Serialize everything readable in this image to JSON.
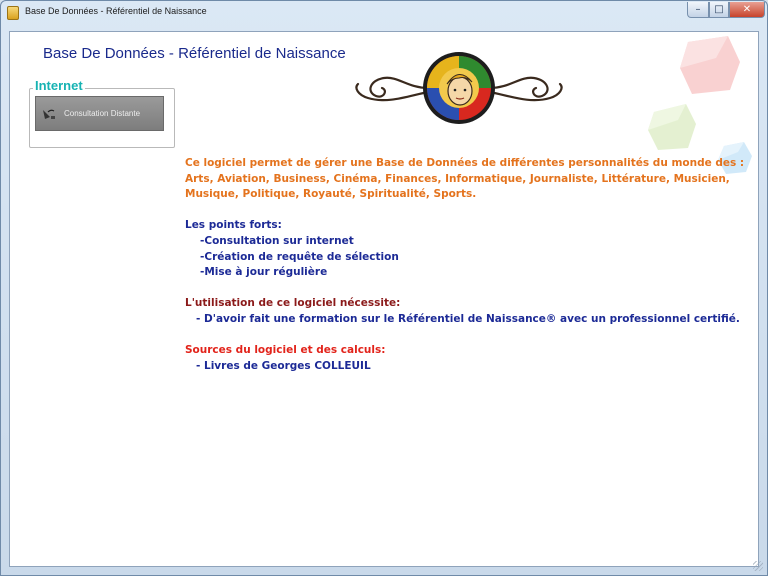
{
  "window": {
    "title": "Base De Données - Référentiel de Naissance",
    "controls": {
      "minimize": "–",
      "maximize": "□",
      "close": "✕"
    }
  },
  "page": {
    "heading": "Base De Données - Référentiel de Naissance"
  },
  "sidebar": {
    "group_label": "Internet",
    "button_label": "Consultation Distante",
    "button_icon": "satellite-dish-icon"
  },
  "description": {
    "intro": [
      "Ce logiciel permet de gérer une Base de Données de différentes personnalités du monde des :",
      "Arts, Aviation, Business, Cinéma, Finances, Informatique, Journaliste, Littérature, Musicien,",
      "Musique, Politique, Royauté, Spiritualité, Sports."
    ],
    "strengths_title": "Les points forts:",
    "strengths": [
      "-Consultation sur internet",
      "-Création de requête de sélection",
      "-Mise à jour régulière"
    ],
    "requirements_title": "L'utilisation de ce logiciel nécessite:",
    "requirements": [
      "- D'avoir fait une formation sur le Référentiel de Naissance® avec un professionnel certifié."
    ],
    "sources_title": "Sources du logiciel et des calculs:",
    "sources": [
      "- Livres de Georges COLLEUIL"
    ]
  },
  "colors": {
    "heading": "#1a2a8c",
    "orange_text": "#e4731d",
    "blue_text": "#1c2a96",
    "darkred_text": "#8b1a1a",
    "red_text": "#e2231a",
    "internet_label": "#17b3b3"
  }
}
